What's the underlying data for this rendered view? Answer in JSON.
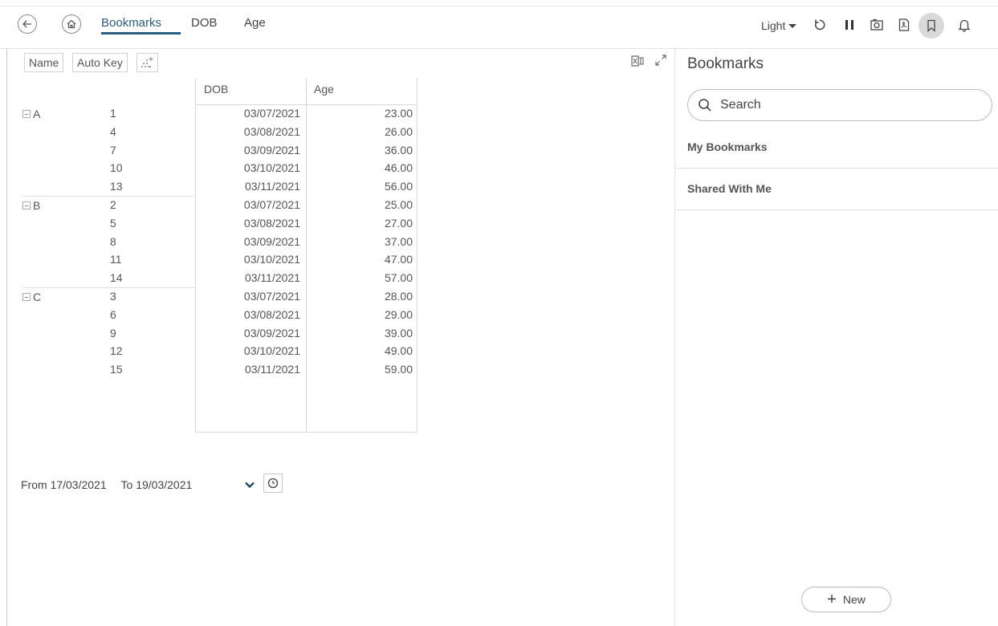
{
  "header": {
    "tabs": [
      {
        "label": "Bookmarks",
        "active": true
      },
      {
        "label": "DOB",
        "active": false
      },
      {
        "label": "Age",
        "active": false
      }
    ],
    "theme": "Light",
    "icons": [
      "back-arrow-icon",
      "home-icon",
      "refresh-icon",
      "pause-icon",
      "snapshot-icon",
      "pdf-icon",
      "bookmark-icon",
      "bell-icon"
    ],
    "accent_color": "#2a5d80"
  },
  "pivot": {
    "chips": [
      "Name",
      "Auto Key"
    ],
    "columns": [
      "DOB",
      "Age"
    ],
    "groups": [
      {
        "name": "A",
        "rows": [
          {
            "key": "1",
            "dob": "03/07/2021",
            "age": "23.00"
          },
          {
            "key": "4",
            "dob": "03/08/2021",
            "age": "26.00"
          },
          {
            "key": "7",
            "dob": "03/09/2021",
            "age": "36.00"
          },
          {
            "key": "10",
            "dob": "03/10/2021",
            "age": "46.00"
          },
          {
            "key": "13",
            "dob": "03/11/2021",
            "age": "56.00"
          }
        ]
      },
      {
        "name": "B",
        "rows": [
          {
            "key": "2",
            "dob": "03/07/2021",
            "age": "25.00"
          },
          {
            "key": "5",
            "dob": "03/08/2021",
            "age": "27.00"
          },
          {
            "key": "8",
            "dob": "03/09/2021",
            "age": "37.00"
          },
          {
            "key": "11",
            "dob": "03/10/2021",
            "age": "47.00"
          },
          {
            "key": "14",
            "dob": "03/11/2021",
            "age": "57.00"
          }
        ]
      },
      {
        "name": "C",
        "rows": [
          {
            "key": "3",
            "dob": "03/07/2021",
            "age": "28.00"
          },
          {
            "key": "6",
            "dob": "03/08/2021",
            "age": "29.00"
          },
          {
            "key": "9",
            "dob": "03/09/2021",
            "age": "39.00"
          },
          {
            "key": "12",
            "dob": "03/10/2021",
            "age": "49.00"
          },
          {
            "key": "15",
            "dob": "03/11/2021",
            "age": "59.00"
          }
        ]
      }
    ]
  },
  "range": {
    "from_label": "From",
    "from": "17/03/2021",
    "to_label": "To",
    "to": "19/03/2021"
  },
  "bookmarks_panel": {
    "title": "Bookmarks",
    "search_placeholder": "Search",
    "sections": [
      "My Bookmarks",
      "Shared With Me"
    ],
    "new_label": "New"
  }
}
